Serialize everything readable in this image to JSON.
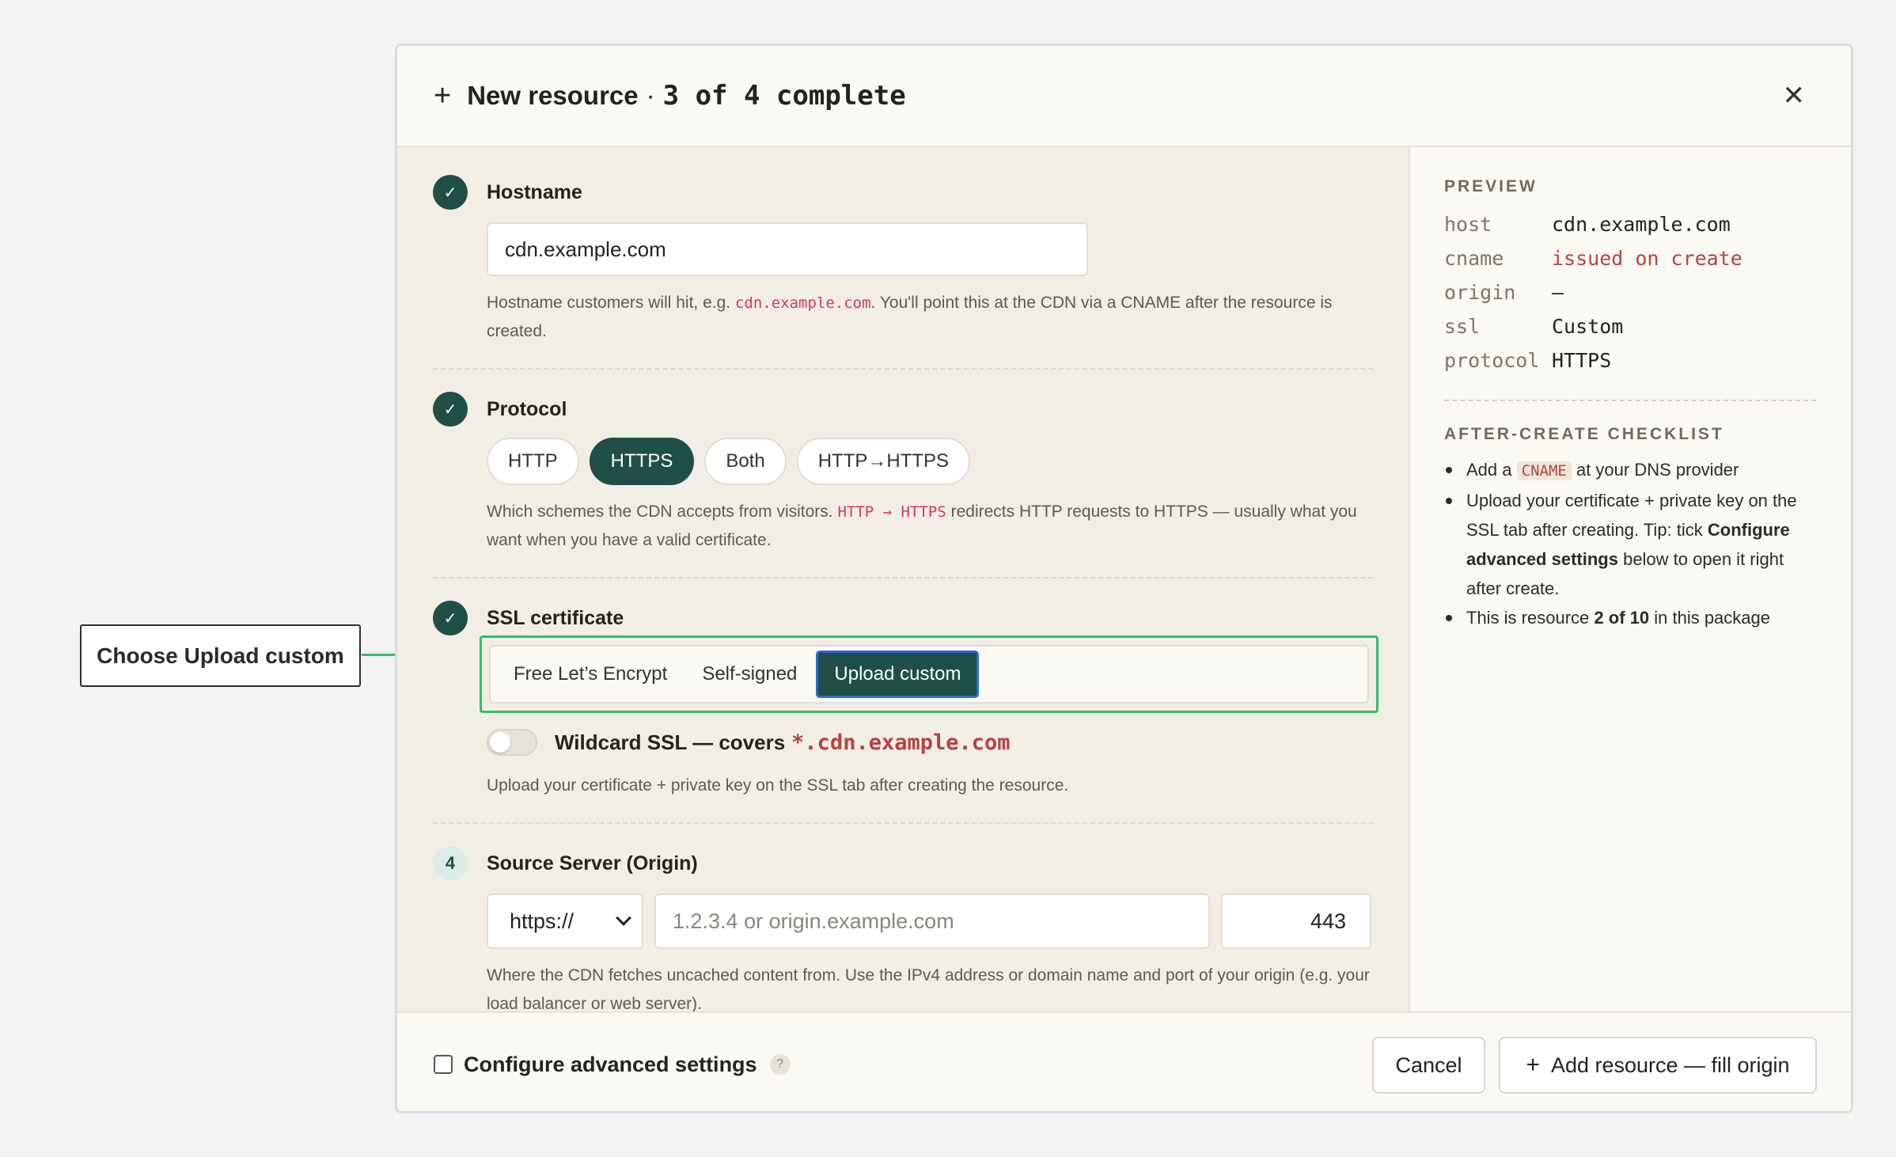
{
  "callout": {
    "label": "Choose Upload custom"
  },
  "header": {
    "title": "New resource",
    "separator": "·",
    "progress": "3 of 4 complete"
  },
  "hostname": {
    "label": "Hostname",
    "value": "cdn.example.com",
    "help_before": "Hostname customers will hit, e.g.",
    "help_code": "cdn.example.com",
    "help_after": ". You'll point this at the CDN via a CNAME after the resource is created."
  },
  "protocol": {
    "label": "Protocol",
    "options": [
      "HTTP",
      "HTTPS",
      "Both",
      "HTTP→HTTPS"
    ],
    "selected": "HTTPS",
    "help_before": "Which schemes the CDN accepts from visitors.",
    "help_code": "HTTP → HTTPS",
    "help_after": "redirects HTTP requests to HTTPS — usually what you want when you have a valid certificate."
  },
  "ssl": {
    "label": "SSL certificate",
    "options": [
      "Free Let’s Encrypt",
      "Self-signed",
      "Upload custom"
    ],
    "selected": "Upload custom",
    "wildcard_label": "Wildcard SSL — covers",
    "wildcard_code": "*.cdn.example.com",
    "wildcard_on": false,
    "help": "Upload your certificate + private key on the SSL tab after creating the resource."
  },
  "origin": {
    "step": "4",
    "label": "Source Server (Origin)",
    "scheme": "https://",
    "placeholder": "1.2.3.4 or origin.example.com",
    "port": "443",
    "help": "Where the CDN fetches uncached content from. Use the IPv4 address or domain name and port of your origin (e.g. your load balancer or web server)."
  },
  "preview": {
    "heading": "PREVIEW",
    "rows": [
      {
        "key": "host",
        "value": "cdn.example.com"
      },
      {
        "key": "cname",
        "value": "issued on create"
      },
      {
        "key": "origin",
        "value": "—"
      },
      {
        "key": "ssl",
        "value": "Custom"
      },
      {
        "key": "protocol",
        "value": "HTTPS"
      }
    ]
  },
  "checklist": {
    "heading": "AFTER-CREATE CHECKLIST",
    "item1_before": "Add a",
    "item1_chip": "CNAME",
    "item1_after": "at your DNS provider",
    "item2_before": "Upload your certificate + private key on the SSL tab after creating. Tip: tick",
    "item2_bold": "Configure advanced settings",
    "item2_after": "below to open it right after create.",
    "item3_before": "This is resource",
    "item3_bold": "2 of 10",
    "item3_after": "in this package"
  },
  "footer": {
    "advanced_label": "Configure advanced settings",
    "help_glyph": "?",
    "cancel": "Cancel",
    "add": "Add resource — fill origin"
  },
  "colors": {
    "accent": "#1f4f46",
    "highlight": "#2fbf6a",
    "focus": "#2a6ad6",
    "code": "#d6336c",
    "warn": "#b5433e"
  }
}
